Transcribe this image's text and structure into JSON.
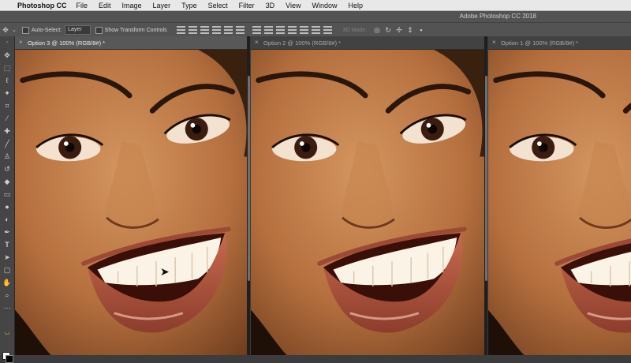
{
  "menubar": {
    "apple_icon": "apple-icon",
    "app_name": "Photoshop CC",
    "items": [
      "File",
      "Edit",
      "Image",
      "Layer",
      "Type",
      "Select",
      "Filter",
      "3D",
      "View",
      "Window",
      "Help"
    ]
  },
  "window": {
    "title": "Adobe Photoshop CC 2018"
  },
  "options": {
    "auto_select_label": "Auto-Select:",
    "auto_select_value": "Layer",
    "show_transform_label": "Show Transform Controls",
    "mode_3d_label": "3D Mode:"
  },
  "documents": [
    {
      "label": "Option 3 @ 100% (RGB/8#) *",
      "active": true
    },
    {
      "label": "Option 2 @ 100% (RGB/8#) *",
      "active": false
    },
    {
      "label": "Option 1 @ 100% (RGB/8#) *",
      "active": false
    }
  ],
  "tools": [
    "move-tool-icon",
    "marquee-tool-icon",
    "lasso-tool-icon",
    "magic-wand-tool-icon",
    "crop-tool-icon",
    "eyedropper-tool-icon",
    "healing-brush-tool-icon",
    "brush-tool-icon",
    "clone-stamp-tool-icon",
    "history-brush-tool-icon",
    "eraser-tool-icon",
    "gradient-tool-icon",
    "blur-tool-icon",
    "dodge-tool-icon",
    "pen-tool-icon",
    "type-tool-icon",
    "path-selection-tool-icon",
    "rectangle-tool-icon",
    "hand-tool-icon",
    "zoom-tool-icon",
    "edit-toolbar-icon"
  ],
  "colors": {
    "foreground": "#ffffff",
    "background": "#000000"
  }
}
